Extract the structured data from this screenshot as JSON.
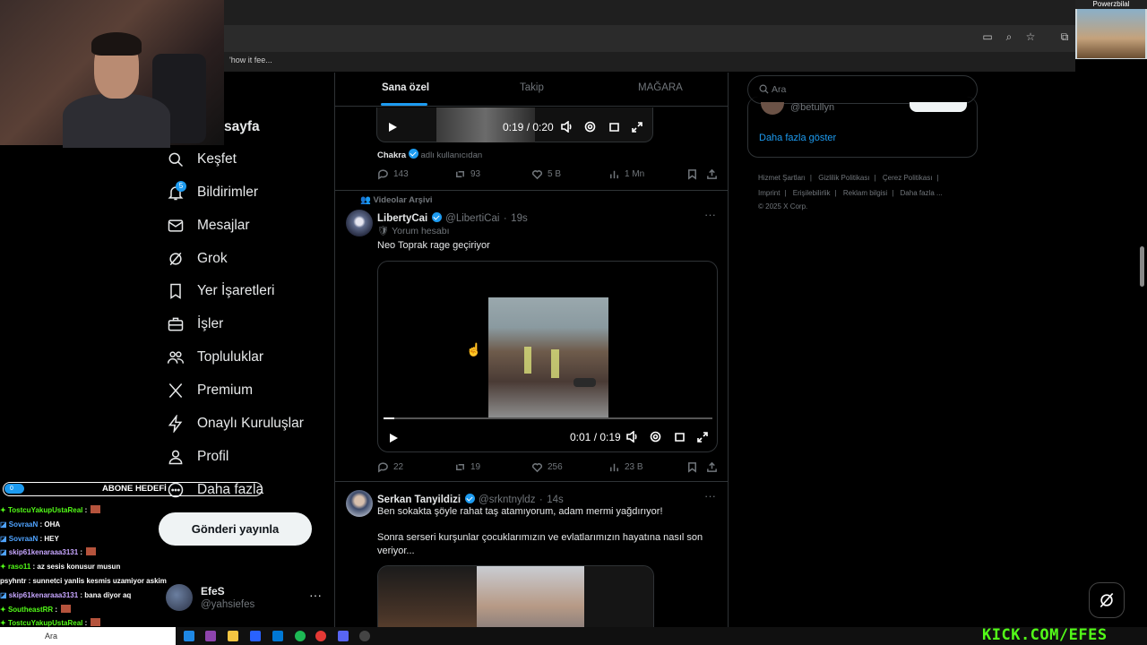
{
  "browser": {
    "bookmark_text": "'how it fee..."
  },
  "stream_overlay": {
    "top_right_label": "Powerzbilal",
    "abone": {
      "count": "0",
      "label": "ABONE HEDEFİ"
    },
    "brand": "KICK.COM/EFES",
    "chat": [
      {
        "user": "TostcuYakupUstaReal",
        "msg": "",
        "color": "green",
        "emote": true
      },
      {
        "user": "SovraaN",
        "msg": "OHA",
        "color": "blue",
        "emote": false
      },
      {
        "user": "SovraaN",
        "msg": "HEY",
        "color": "blue",
        "emote": false
      },
      {
        "user": "skip61kenaraaa3131",
        "msg": "",
        "color": "pink",
        "emote": true
      },
      {
        "user": "raso11",
        "msg": "az sesis konusur musun",
        "color": "green",
        "emote": false
      },
      {
        "user": "psyhntr",
        "msg": "sunnetci yanlis kesmis uzamiyor askim",
        "color": "white",
        "emote": false
      },
      {
        "user": "skip61kenaraaa3131",
        "msg": "bana diyor aq",
        "color": "pink",
        "emote": false
      },
      {
        "user": "SoutheastRR",
        "msg": "",
        "color": "green",
        "emote": true
      },
      {
        "user": "TostcuYakupUstaReal",
        "msg": "",
        "color": "green",
        "emote": true
      }
    ]
  },
  "sidebar": {
    "partial_label": "sayfa",
    "items": [
      {
        "label": "Keşfet",
        "icon": "search-icon"
      },
      {
        "label": "Bildirimler",
        "icon": "bell-icon",
        "badge": "5"
      },
      {
        "label": "Mesajlar",
        "icon": "mail-icon"
      },
      {
        "label": "Grok",
        "icon": "grok-icon"
      },
      {
        "label": "Yer İşaretleri",
        "icon": "bookmark-icon"
      },
      {
        "label": "İşler",
        "icon": "briefcase-icon"
      },
      {
        "label": "Topluluklar",
        "icon": "people-icon"
      },
      {
        "label": "Premium",
        "icon": "x-logo-icon"
      },
      {
        "label": "Onaylı Kuruluşlar",
        "icon": "lightning-icon"
      },
      {
        "label": "Profil",
        "icon": "person-icon"
      },
      {
        "label": "Daha fazla",
        "icon": "more-circle-icon"
      }
    ],
    "post_button": "Gönderi yayınla",
    "account": {
      "name": "EfeS",
      "handle": "@yahsiefes"
    }
  },
  "tabs": [
    "Sana özel",
    "Takip",
    "MAĞARA"
  ],
  "posts": [
    {
      "id": "p1",
      "video_time": "0:19 / 0:20",
      "source_user": "Chakra",
      "source_text": "adlı kullanıcıdan",
      "stats": {
        "replies": "143",
        "reposts": "93",
        "likes": "5 B",
        "views": "1 Mn"
      }
    },
    {
      "id": "p2",
      "context": "Videolar Arşivi",
      "name": "LibertyCai",
      "handle": "@LibertiCai",
      "time": "19s",
      "label": "Yorum hesabı",
      "text": "Neo Toprak rage geçiriyor",
      "video_time": "0:01 / 0:19",
      "stats": {
        "replies": "22",
        "reposts": "19",
        "likes": "256",
        "views": "23 B"
      }
    },
    {
      "id": "p3",
      "name": "Serkan Tanyildizi",
      "handle": "@srkntnyldz",
      "time": "14s",
      "text_line1": "Ben sokakta şöyle rahat taş atamıyorum, adam mermi yağdırıyor!",
      "text_line2": "Sonra serseri kurşunlar çocuklarımızın ve evlatlarımızın hayatına nasıl son veriyor..."
    }
  ],
  "right": {
    "search_placeholder": "Ara",
    "who_handle": "@betullyn",
    "show_more": "Daha fazla göster",
    "footer_row1": [
      "Hizmet Şartları",
      "Gizlilik Politikası",
      "Çerez Politikası"
    ],
    "footer_row2": [
      "Imprint",
      "Erişilebilirlik",
      "Reklam bilgisi",
      "Daha fazla ..."
    ],
    "copyright": "© 2025 X Corp."
  },
  "taskbar": {
    "search_label": "Ara"
  },
  "colors": {
    "accent": "#1d9bf0",
    "kick_green": "#53fc18",
    "bg": "#000000",
    "border": "#2f3336"
  }
}
